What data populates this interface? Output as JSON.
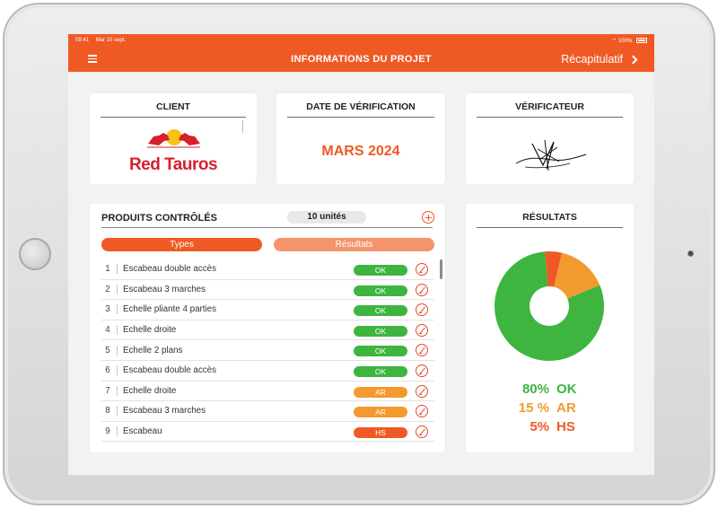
{
  "status_bar": {
    "time": "09:41",
    "date": "Mar 10 sept.",
    "battery": "100%"
  },
  "nav": {
    "title": "INFORMATIONS DU PROJET",
    "recap_label": "Récapitulatif"
  },
  "client": {
    "title": "CLIENT",
    "logo_text": "Red Tauros"
  },
  "verification": {
    "title": "DATE DE VÉRIFICATION",
    "date": "MARS 2024"
  },
  "verifier": {
    "title": "VÉRIFICATEUR"
  },
  "products": {
    "title": "PRODUITS CONTRÔLÉS",
    "units": "10 unités",
    "tab_types": "Types",
    "tab_results": "Résultats",
    "rows": [
      {
        "num": "1",
        "name": "Escabeau double accès",
        "status": "OK"
      },
      {
        "num": "2",
        "name": "Escabeau 3 marches",
        "status": "OK"
      },
      {
        "num": "3",
        "name": "Echelle pliante 4 parties",
        "status": "OK"
      },
      {
        "num": "4",
        "name": "Echelle droite",
        "status": "OK"
      },
      {
        "num": "5",
        "name": "Echelle 2 plans",
        "status": "OK"
      },
      {
        "num": "6",
        "name": "Escabeau double accès",
        "status": "OK"
      },
      {
        "num": "7",
        "name": "Echelle droite",
        "status": "AR"
      },
      {
        "num": "8",
        "name": "Escabeau 3 marches",
        "status": "AR"
      },
      {
        "num": "9",
        "name": "Escabeau",
        "status": "HS"
      }
    ]
  },
  "results": {
    "title": "RÉSULTATS",
    "slices": [
      {
        "label": "OK",
        "pct": "80%",
        "value": 80,
        "color": "#3db53f"
      },
      {
        "label": "AR",
        "pct": "15 %",
        "value": 15,
        "color": "#f29a2e"
      },
      {
        "label": "HS",
        "pct": "5%",
        "value": 5,
        "color": "#ef5a24"
      }
    ]
  },
  "colors": {
    "accent": "#ef5a24",
    "ok": "#3db53f",
    "ar": "#f29a2e",
    "hs": "#ef5a24"
  }
}
